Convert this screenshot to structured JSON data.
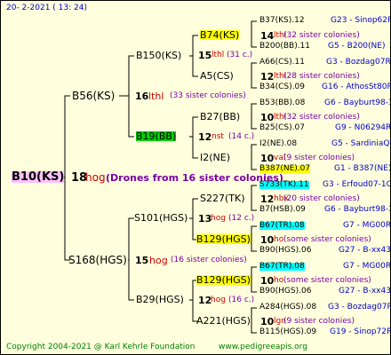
{
  "header": {
    "date": "20-  2-2021  (  13:  24)"
  },
  "footer": {
    "copyright": "Copyright 2004-2021 @ Karl Kehrle Foundation",
    "site": "www.pedigreeapis.org"
  },
  "root": {
    "label": "B10(KS)",
    "num": "18",
    "marker": "hog",
    "note": "(Drones from 16 sister colonies)",
    "queen": {
      "label": "B56(KS)",
      "num": "16",
      "marker": "lthl",
      "count": "(33 sister colonies)",
      "queen": {
        "label": "B150(KS)",
        "num": "15",
        "marker": "lthl",
        "count": "(31 c.)",
        "queen": {
          "label": "B74(KS)",
          "num": "14",
          "marker": "lthl",
          "count": "(32 sister colonies)",
          "queen": {
            "label": "B37(KS).12",
            "link": "G23 - Sinop62R"
          },
          "drone": {
            "label": "B200(BB).11",
            "link": "G5 - B200(NE)"
          }
        },
        "drone": {
          "label": "A5(CS)",
          "num": "12",
          "marker": "lthl",
          "count": "(28 sister colonies)",
          "queen": {
            "label": "A66(CS).11",
            "link": "G3 - Bozdag07R"
          },
          "drone": {
            "label": "B34(CS).09",
            "link": "G16 - AthosSt80R"
          }
        }
      },
      "drone": {
        "label": "B19(BB)",
        "num": "12",
        "marker": "nst",
        "count": "(14 c.)",
        "queen": {
          "label": "B27(BB)",
          "num": "10",
          "marker": "lthl",
          "count": "(32 sister colonies)",
          "queen": {
            "label": "B53(BB).08",
            "link": "G6 - Bayburt98-3"
          },
          "drone": {
            "label": "B25(CS).07",
            "link": "G9 - N06294R"
          }
        },
        "drone": {
          "label": "I2(NE)",
          "num": "10",
          "marker": "val",
          "count": "(9 sister colonies)",
          "queen": {
            "label": "I2(NE).08",
            "link": "G5 - SardiniaQ"
          },
          "drone": {
            "label": "B387(NE).07",
            "link": "G1 - B387(NE)"
          }
        }
      }
    },
    "drone": {
      "label": "S168(HGS)",
      "num": "15",
      "marker": "hog",
      "count": "(16 sister colonies)",
      "queen": {
        "label": "S101(HGS)",
        "num": "13",
        "marker": "hog",
        "count": "(12 c.)",
        "queen": {
          "label": "S227(TK)",
          "num": "12",
          "marker": "hbx",
          "count": "(20 sister colonies)",
          "queen": {
            "label": "S733(TK).11",
            "link": "G3 - Erfoud07-1Q"
          },
          "drone": {
            "label": "B7(HSB).09",
            "link": "G6 - Bayburt98-3"
          }
        },
        "drone": {
          "label": "B129(HGS)",
          "num": "10",
          "marker": "ho",
          "count": "(some sister colonies)",
          "queen": {
            "label": "B67(TR).08",
            "link": "G7 - MG00R"
          },
          "drone": {
            "label": "B90(HGS).06",
            "link": "G27 - B-xx43"
          }
        }
      },
      "drone": {
        "label": "B29(HGS)",
        "num": "12",
        "marker": "hog",
        "count": "(16 c.)",
        "queen": {
          "label": "B129(HGS)",
          "num": "10",
          "marker": "ho",
          "count": "(some sister colonies)",
          "queen": {
            "label": "B67(TR).08",
            "link": "G7 - MG00R"
          },
          "drone": {
            "label": "B90(HGS).06",
            "link": "G27 - B-xx43"
          }
        },
        "drone": {
          "label": "A221(HGS)",
          "num": "10",
          "marker": "lgn",
          "count": "(9 sister colonies)",
          "queen": {
            "label": "A284(HGS).08",
            "link": "G3 - Bozdag07R"
          },
          "drone": {
            "label": "B115(HGS).09",
            "link": "G19 - Sinop72R"
          }
        }
      }
    }
  }
}
